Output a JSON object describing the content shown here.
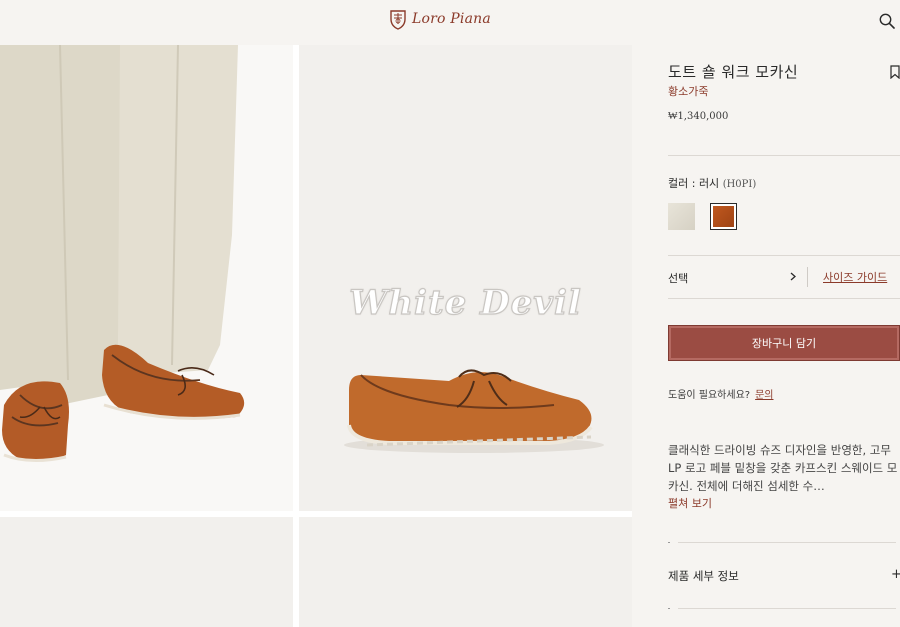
{
  "header": {
    "brand": "Loro Piana",
    "search_icon": "search-icon"
  },
  "gallery": {
    "watermark": "White Devil",
    "images": [
      {
        "name": "model-wearing-loafers"
      },
      {
        "name": "loafer-side-view"
      },
      {
        "name": "image-placeholder-3"
      },
      {
        "name": "image-placeholder-4"
      }
    ]
  },
  "product": {
    "title": "도트 숄 워크 모카신",
    "material": "황소가죽",
    "price": "₩1,340,000",
    "color_label": "컬러 : 러시",
    "color_code": "(H0PI)",
    "swatches": [
      {
        "name": "ivory",
        "color": "#e2ddd1"
      },
      {
        "name": "rust",
        "color": "#b1501a",
        "selected": true
      }
    ],
    "select_label": "선택",
    "size_guide": "사이즈 가이드",
    "add_to_cart": "장바구니 담기",
    "help_text": "도움이 필요하세요?",
    "help_link": "문의",
    "description": "클래식한 드라이빙 슈즈 디자인을 반영한, 고무 LP 로고 페블 밑창을 갖춘 카프스킨 스웨이드 모카신. 전체에 더해진 섬세한 수…",
    "read_more": "펼쳐 보기",
    "details_label": "제품 세부 정보",
    "details_icon": "+"
  },
  "colors": {
    "accent": "#8b3a2a",
    "button": "#9b4c43",
    "panel_bg": "#f6f4f1"
  }
}
